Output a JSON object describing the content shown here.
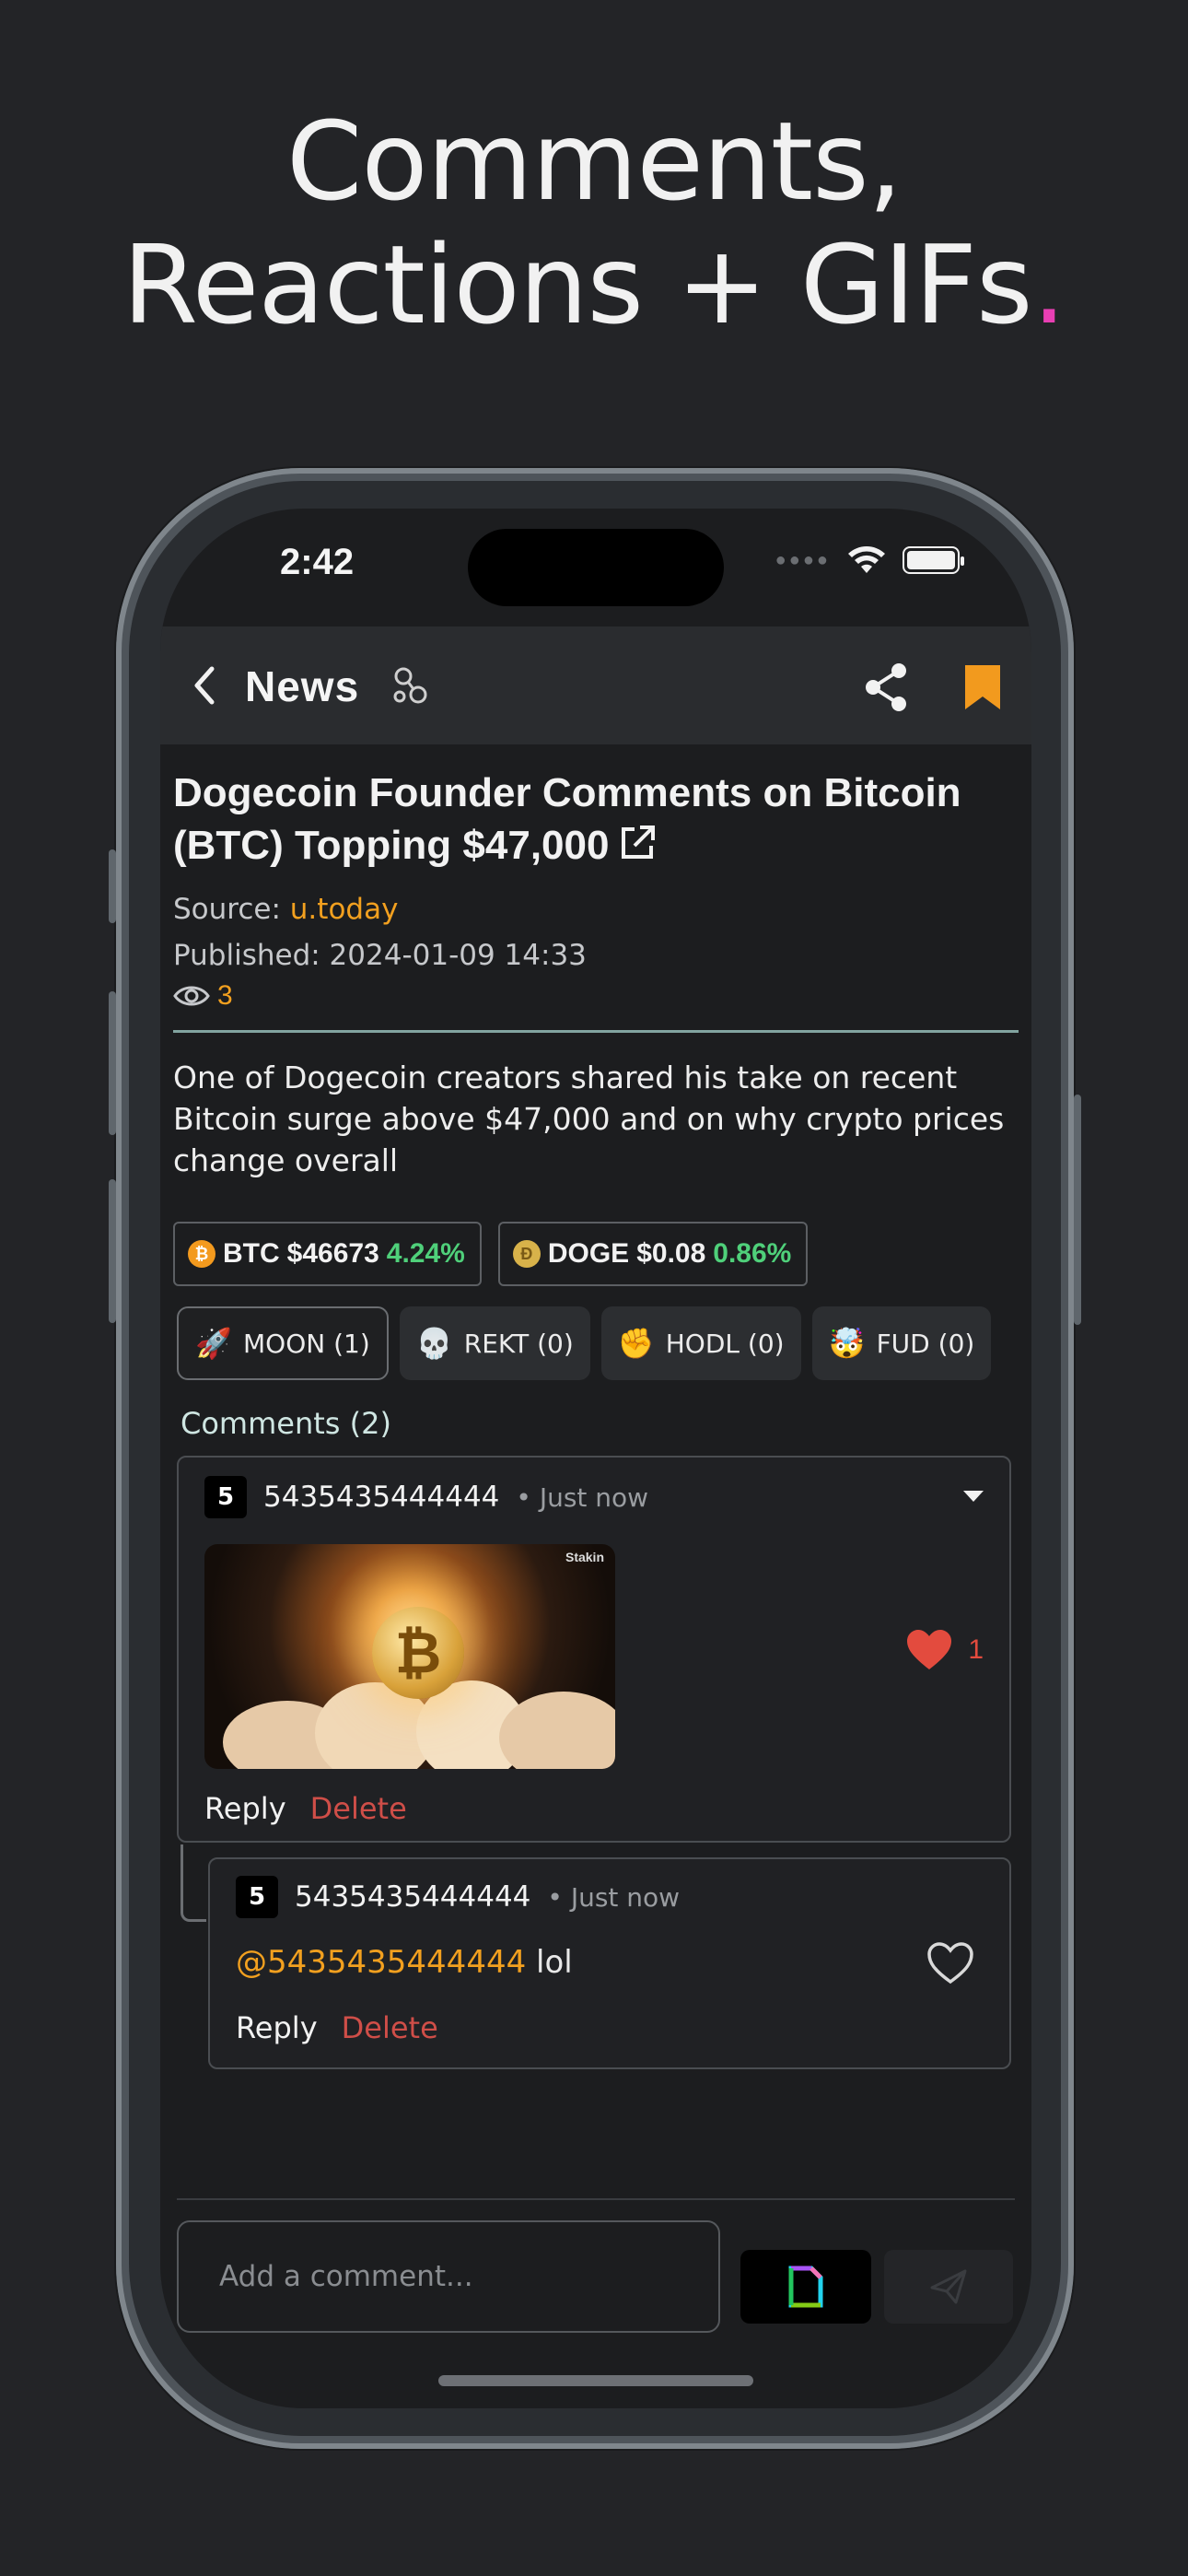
{
  "headline": {
    "line1": "Comments,",
    "line2": "Reactions + GIFs",
    "dot": "."
  },
  "status_bar": {
    "time": "2:42"
  },
  "navbar": {
    "title": "News"
  },
  "article": {
    "title": "Dogecoin Founder Comments on Bitcoin (BTC) Topping $47,000",
    "source_label": "Source: ",
    "source": "u.today",
    "published": "Published: 2024-01-09 14:33",
    "views": "3",
    "summary": "One of Dogecoin creators shared his take on recent Bitcoin surge above $47,000 and on why crypto prices change overall"
  },
  "tickers": [
    {
      "symbol": "BTC",
      "price": "$46673",
      "change": "4.24%",
      "coin_icon": "bitcoin-coin-icon",
      "coin_glyph": "₿"
    },
    {
      "symbol": "DOGE",
      "price": "$0.08",
      "change": "0.86%",
      "coin_icon": "doge-coin-icon",
      "coin_glyph": "Ð"
    }
  ],
  "reactions": [
    {
      "emoji": "🚀",
      "label": "MOON (1)",
      "icon": "rocket-icon",
      "active": true
    },
    {
      "emoji": "💀",
      "label": "REKT (0)",
      "icon": "skull-icon",
      "active": false
    },
    {
      "emoji": "✊",
      "label": "HODL (0)",
      "icon": "fist-icon",
      "active": false
    },
    {
      "emoji": "🤯",
      "label": "FUD (0)",
      "icon": "exploding-head-icon",
      "active": false
    }
  ],
  "comments_label": "Comments (2)",
  "comments": [
    {
      "avatar": "5",
      "user": "5435435444444",
      "time": "• Just now",
      "gif_watermark": "Stakin",
      "gif_glyph": "₿",
      "likes": "1",
      "liked": true,
      "reply": "Reply",
      "delete": "Delete"
    },
    {
      "avatar": "5",
      "user": "5435435444444",
      "time": "• Just now",
      "mention": "@5435435444444",
      "text": " lol",
      "liked": false,
      "reply": "Reply",
      "delete": "Delete"
    }
  ],
  "composer": {
    "placeholder": "Add a comment..."
  },
  "colors": {
    "accent_orange": "#f2a01f",
    "positive_green": "#4fd07a",
    "heart_red": "#e34b3e",
    "delete_red": "#cf4e48",
    "headline_dot": "#e83fb3"
  }
}
